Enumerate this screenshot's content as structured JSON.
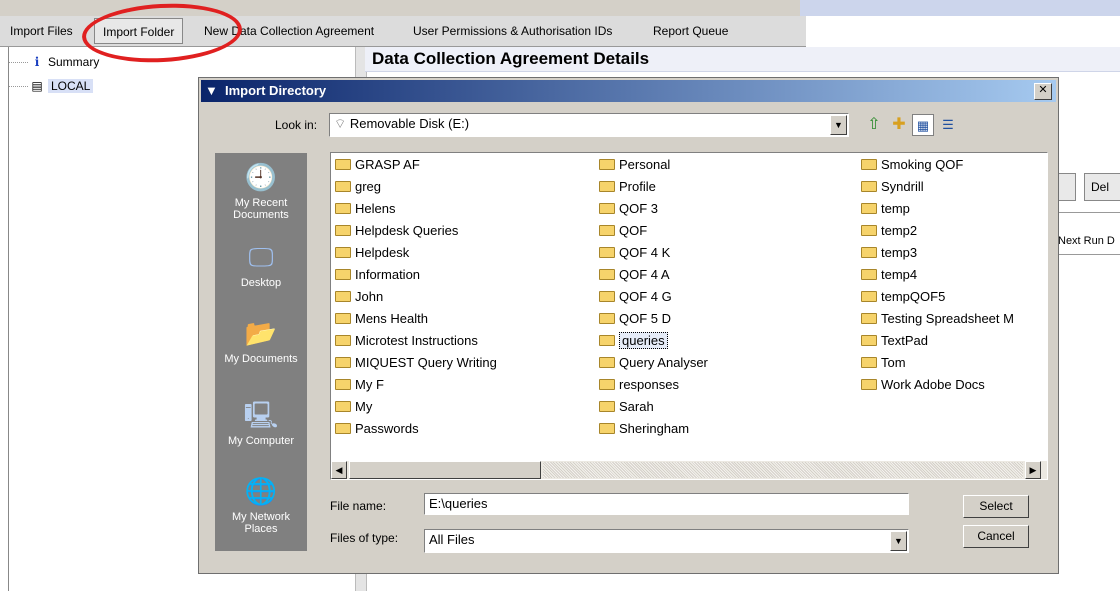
{
  "toolbar": {
    "import_files": "Import Files",
    "import_folder": "Import Folder",
    "new_agreement": "New Data Collection Agreement",
    "user_permissions": "User Permissions & Authorisation IDs",
    "report_queue": "Report Queue"
  },
  "tree": {
    "summary": "Summary",
    "local": "LOCAL"
  },
  "details_title": "Data Collection Agreement Details",
  "background": {
    "button_partial": "Del",
    "next_run_label": "Next Run D"
  },
  "dialog": {
    "title": "Import Directory",
    "look_in_label": "Look in:",
    "look_in_value": "Removable Disk (E:)",
    "places": [
      "My Recent Documents",
      "Desktop",
      "My Documents",
      "My Computer",
      "My Network Places"
    ],
    "folders_col1": [
      "GRASP AF",
      "greg",
      "Helens",
      "Helpdesk Queries",
      "Helpdesk",
      "Information",
      "John",
      "Mens Health",
      "Microtest Instructions",
      "MIQUEST Query Writing",
      "My F",
      "My",
      "Passwords"
    ],
    "folders_col2": [
      "Personal",
      "Profile",
      "QOF 3",
      "QOF",
      "QOF 4   K",
      "QOF 4 A",
      "QOF 4 G",
      "QOF 5 D",
      "queries",
      "Query Analyser",
      "responses",
      "Sarah",
      "Sheringham"
    ],
    "folders_col3": [
      "Smoking QOF",
      "Syndrill",
      "temp",
      "temp2",
      "temp3",
      "temp4",
      "tempQOF5",
      "Testing Spreadsheet M",
      "TextPad",
      "Tom",
      "Work Adobe Docs"
    ],
    "selected_folder": "queries",
    "file_name_label": "File name:",
    "file_name_value": "E:\\queries",
    "file_type_label": "Files of type:",
    "file_type_value": "All Files",
    "select_button": "Select",
    "cancel_button": "Cancel"
  },
  "colors": {
    "titlebar_start": "#0a246a",
    "titlebar_end": "#a6caf0",
    "annotation": "#e02020",
    "dialog_face": "#d4d0c8"
  }
}
